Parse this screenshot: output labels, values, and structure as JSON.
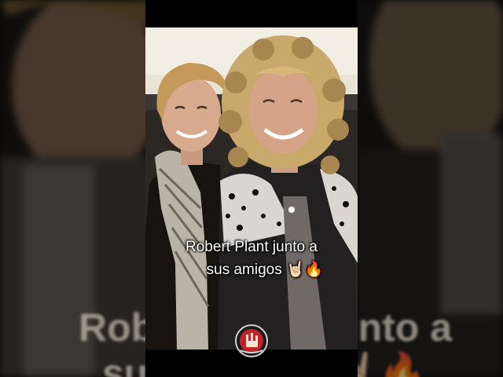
{
  "caption": {
    "line1": "Robert Plant junto a",
    "line2": "sus amigos 🤘🏻🔥"
  },
  "background_caption": {
    "line1": "Robert Plant junto a",
    "line2": "sus amigos 🤘🏻🔥"
  },
  "colors": {
    "letterbox": "#000000",
    "caption_text": "#ffffff",
    "photo_bg": "#e9e4d6",
    "leopard_jacket": "#2a2a2a",
    "logo_red": "#c0242a"
  },
  "icons": {
    "logo": "rock-horns-logo-icon"
  }
}
